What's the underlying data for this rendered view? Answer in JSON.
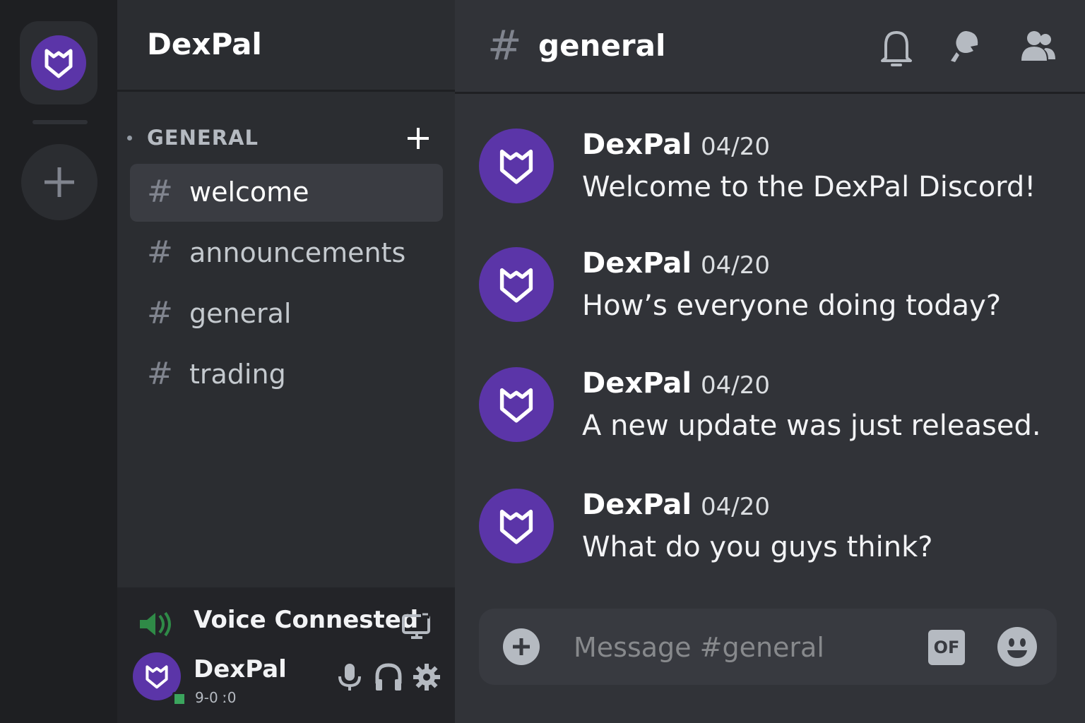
{
  "server": {
    "name": "DexPal"
  },
  "category": {
    "label": "GENERAL"
  },
  "channels": [
    {
      "label": "welcome",
      "active": true
    },
    {
      "label": "announcements",
      "active": false
    },
    {
      "label": "general",
      "active": false
    },
    {
      "label": "trading",
      "active": false
    }
  ],
  "hash_symbol": "#",
  "voice": {
    "status": "Voice Connested"
  },
  "user": {
    "name": "DexPal",
    "tag": "9-0 ː0"
  },
  "header": {
    "channel": "general"
  },
  "messages": [
    {
      "author": "DexPal",
      "time": "04/20",
      "text": "Welcome to the DexPal Discord!"
    },
    {
      "author": "DexPal",
      "time": "04/20",
      "text": "How’s everyone doing today?"
    },
    {
      "author": "DexPal",
      "time": "04/20",
      "text": "A new update was just released."
    },
    {
      "author": "DexPal",
      "time": "04/20",
      "text": "What do you guys think?"
    }
  ],
  "composer": {
    "placeholder": "Message #general",
    "gif_label": "OF"
  },
  "colors": {
    "brand": "#5b35a8",
    "background": "#313338",
    "sidebar": "#2b2d31",
    "rail": "#1e1f22",
    "online": "#3ba55d"
  },
  "icons": [
    "shield-logo-icon",
    "plus-icon",
    "hash-icon",
    "speaker-icon",
    "screen-share-icon",
    "microphone-icon",
    "headphones-icon",
    "gear-icon",
    "bell-icon",
    "threads-icon",
    "members-icon",
    "add-attachment-icon",
    "gif-icon",
    "emoji-icon"
  ]
}
